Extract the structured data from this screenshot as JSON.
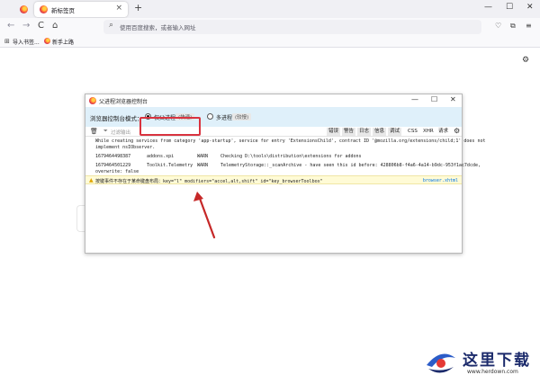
{
  "browser": {
    "tab_title": "新标签页",
    "tab_close": "×",
    "newtab": "+",
    "win_min": "—",
    "win_max": "☐",
    "win_close": "✕",
    "nav_back": "←",
    "nav_forward": "→",
    "nav_reload": "C",
    "nav_home": "⌂",
    "url_placeholder": "使用百度搜索，或者输入网址",
    "bookmarks": [
      {
        "icon": "import-icon",
        "label": "导入书签..."
      },
      {
        "icon": "firefox-icon",
        "label": "新手上路"
      }
    ]
  },
  "console": {
    "title": "父进程浏览器控制台",
    "mode_label": "浏览器控制台模式：",
    "options": [
      {
        "label": "仅父进程",
        "hint": "(快速)",
        "selected": true
      },
      {
        "label": "多进程",
        "hint": "(较慢)",
        "selected": false
      }
    ],
    "filter_placeholder": "过滤输出",
    "filter_buttons": [
      "错误",
      "警告",
      "日志",
      "信息",
      "调试",
      "CSS",
      "XHR",
      "请求"
    ],
    "logs": [
      {
        "lines": [
          "While creating services from category 'app-startup', service for entry 'ExtensionsChild', contract ID '@mozilla.org/extensions/child;1' does not",
          "implement nsIObserver."
        ]
      },
      {
        "time": "1679464498387",
        "module": "addons.xpi",
        "level": "WARN",
        "message": "Checking D:\\tools\\distribution\\extensions for addons"
      },
      {
        "time": "1679464501229",
        "module": "Toolkit.Telemetry",
        "level": "WARN",
        "message": "TelemetryStorage::_scanArchive - have seen this id before: 428806b8-f4a6-4a14-b9dc-953f1ac7dcde,",
        "cont": "overwrite: false"
      }
    ],
    "warning": {
      "text": "按键事件不存在于某命键盘布局：key=\"l\" modifiers=\"accel,alt,shift\" id=\"key_browserToolbox\"",
      "source": "browser.xhtml"
    }
  },
  "watermark": {
    "title": "这里下载",
    "url": "www.herdown.com"
  },
  "colors": {
    "highlight_border": "#d9333f",
    "arrow": "#c62828",
    "mode_bar_bg": "#dff0fa",
    "warning_bg": "#fffbd6",
    "link": "#0074e8"
  }
}
